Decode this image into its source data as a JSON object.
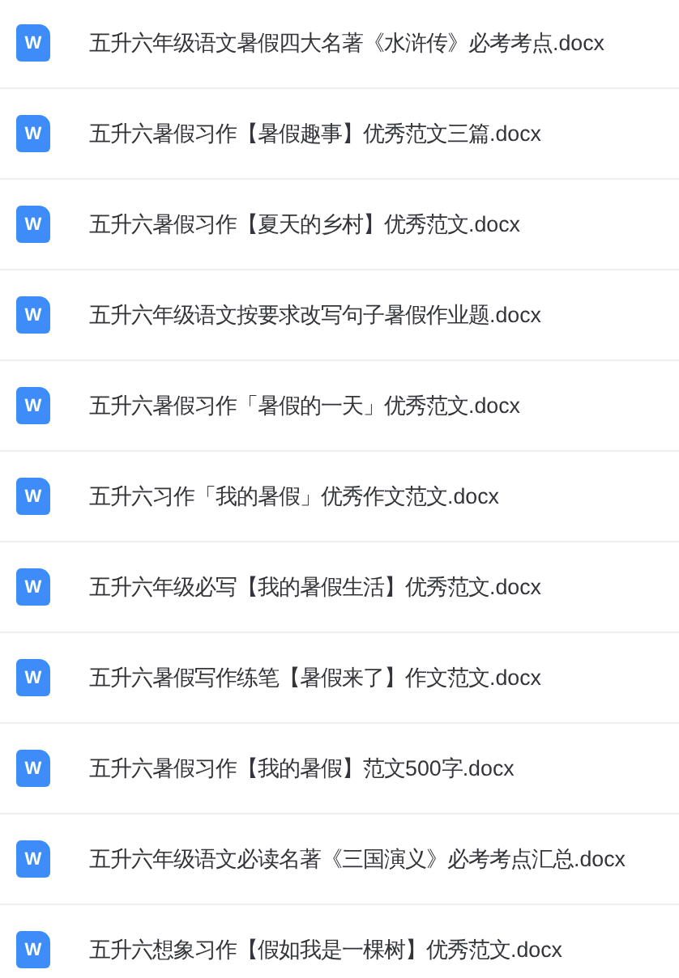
{
  "files": [
    {
      "icon_letter": "W",
      "name": "五升六年级语文暑假四大名著《水浒传》必考考点.docx"
    },
    {
      "icon_letter": "W",
      "name": "五升六暑假习作【暑假趣事】优秀范文三篇.docx"
    },
    {
      "icon_letter": "W",
      "name": "五升六暑假习作【夏天的乡村】优秀范文.docx"
    },
    {
      "icon_letter": "W",
      "name": "五升六年级语文按要求改写句子暑假作业题.docx"
    },
    {
      "icon_letter": "W",
      "name": "五升六暑假习作「暑假的一天」优秀范文.docx"
    },
    {
      "icon_letter": "W",
      "name": "五升六习作「我的暑假」优秀作文范文.docx"
    },
    {
      "icon_letter": "W",
      "name": "五升六年级必写【我的暑假生活】优秀范文.docx"
    },
    {
      "icon_letter": "W",
      "name": "五升六暑假写作练笔【暑假来了】作文范文.docx"
    },
    {
      "icon_letter": "W",
      "name": "五升六暑假习作【我的暑假】范文500字.docx"
    },
    {
      "icon_letter": "W",
      "name": "五升六年级语文必读名著《三国演义》必考考点汇总.docx"
    },
    {
      "icon_letter": "W",
      "name": "五升六想象习作【假如我是一棵树】优秀范文.docx"
    }
  ]
}
